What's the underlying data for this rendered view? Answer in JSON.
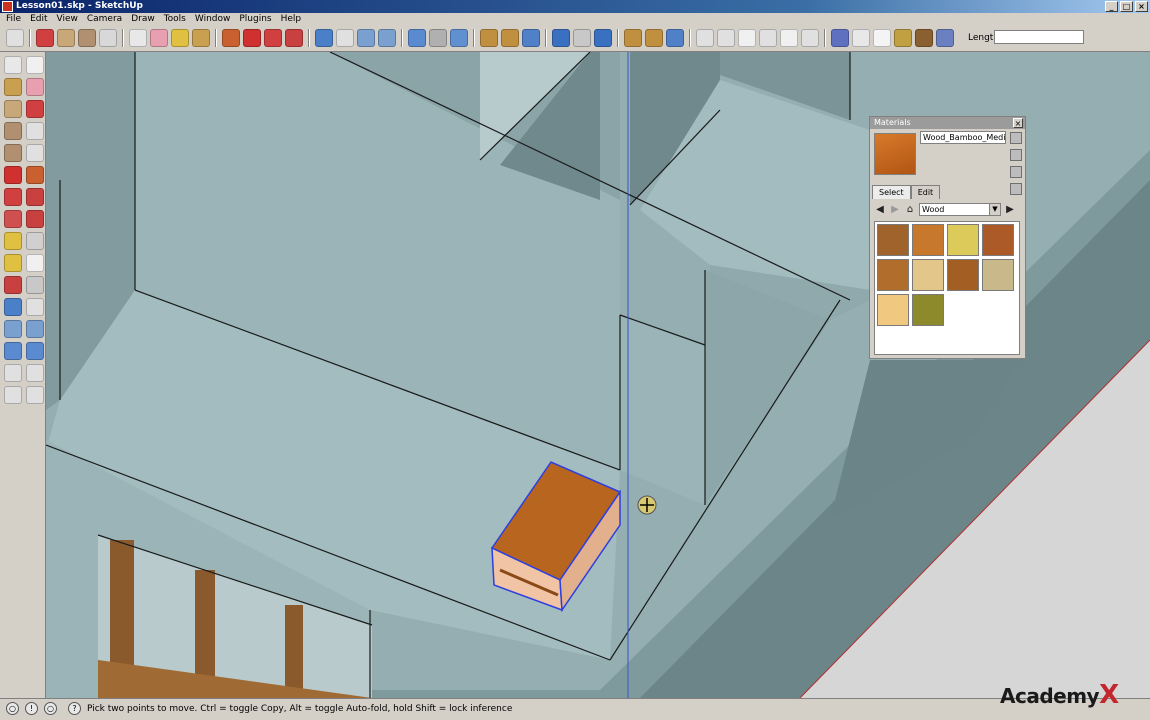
{
  "window": {
    "title": "Lesson01.skp - SketchUp"
  },
  "menu": [
    "File",
    "Edit",
    "View",
    "Camera",
    "Draw",
    "Tools",
    "Window",
    "Plugins",
    "Help"
  ],
  "toolbar": {
    "length_label": "Length",
    "length_value": ""
  },
  "materials": {
    "title": "Materials",
    "material_name": "Wood_Bamboo_Medium",
    "tabs": [
      "Select",
      "Edit"
    ],
    "category": "Wood",
    "swatch_colors": [
      "#a0632c",
      "#c8782c",
      "#dccb5a",
      "#ab5a28",
      "#b06d2c",
      "#e2c68a",
      "#a35e23",
      "#c9b98a",
      "#f0c880",
      "#8c8a2a"
    ]
  },
  "status": {
    "text": "Pick two points to move.  Ctrl = toggle Copy, Alt = toggle Auto-fold, hold Shift = lock inference"
  },
  "watermark": {
    "text": "Academy",
    "mark": "X"
  }
}
